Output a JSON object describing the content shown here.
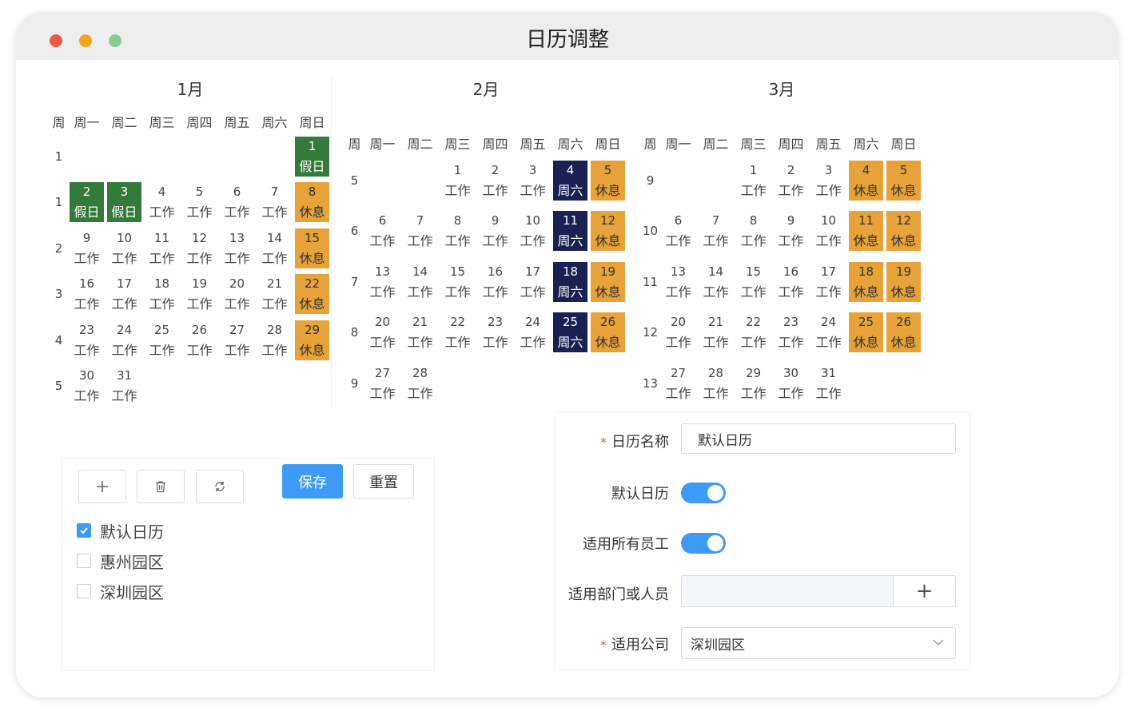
{
  "window": {
    "title": "日历调整"
  },
  "weekday_headers": [
    "周",
    "周一",
    "周二",
    "周三",
    "周四",
    "周五",
    "周六",
    "周日"
  ],
  "months": [
    {
      "title": "1月",
      "weeks": [
        {
          "num": "1",
          "days": [
            null,
            null,
            null,
            null,
            null,
            null,
            {
              "d": "1",
              "t": "假日",
              "type": "holiday"
            }
          ]
        },
        {
          "num": "1",
          "days": [
            {
              "d": "2",
              "t": "假日",
              "type": "holiday"
            },
            {
              "d": "3",
              "t": "假日",
              "type": "holiday"
            },
            {
              "d": "4",
              "t": "工作"
            },
            {
              "d": "5",
              "t": "工作"
            },
            {
              "d": "6",
              "t": "工作"
            },
            {
              "d": "7",
              "t": "工作"
            },
            {
              "d": "8",
              "t": "休息",
              "type": "rest"
            }
          ]
        },
        {
          "num": "2",
          "days": [
            {
              "d": "9",
              "t": "工作"
            },
            {
              "d": "10",
              "t": "工作"
            },
            {
              "d": "11",
              "t": "工作"
            },
            {
              "d": "12",
              "t": "工作"
            },
            {
              "d": "13",
              "t": "工作"
            },
            {
              "d": "14",
              "t": "工作"
            },
            {
              "d": "15",
              "t": "休息",
              "type": "rest"
            }
          ]
        },
        {
          "num": "3",
          "days": [
            {
              "d": "16",
              "t": "工作"
            },
            {
              "d": "17",
              "t": "工作"
            },
            {
              "d": "18",
              "t": "工作"
            },
            {
              "d": "19",
              "t": "工作"
            },
            {
              "d": "20",
              "t": "工作"
            },
            {
              "d": "21",
              "t": "工作"
            },
            {
              "d": "22",
              "t": "休息",
              "type": "rest"
            }
          ]
        },
        {
          "num": "4",
          "days": [
            {
              "d": "23",
              "t": "工作"
            },
            {
              "d": "24",
              "t": "工作"
            },
            {
              "d": "25",
              "t": "工作"
            },
            {
              "d": "26",
              "t": "工作"
            },
            {
              "d": "27",
              "t": "工作"
            },
            {
              "d": "28",
              "t": "工作"
            },
            {
              "d": "29",
              "t": "休息",
              "type": "rest"
            }
          ]
        },
        {
          "num": "5",
          "days": [
            {
              "d": "30",
              "t": "工作"
            },
            {
              "d": "31",
              "t": "工作"
            },
            null,
            null,
            null,
            null,
            null
          ]
        }
      ]
    },
    {
      "title": "2月",
      "weeks": [
        {
          "num": "5",
          "days": [
            null,
            null,
            {
              "d": "1",
              "t": "工作"
            },
            {
              "d": "2",
              "t": "工作"
            },
            {
              "d": "3",
              "t": "工作"
            },
            {
              "d": "4",
              "t": "周六",
              "type": "sat"
            },
            {
              "d": "5",
              "t": "休息",
              "type": "rest"
            }
          ]
        },
        {
          "num": "6",
          "days": [
            {
              "d": "6",
              "t": "工作"
            },
            {
              "d": "7",
              "t": "工作"
            },
            {
              "d": "8",
              "t": "工作"
            },
            {
              "d": "9",
              "t": "工作"
            },
            {
              "d": "10",
              "t": "工作"
            },
            {
              "d": "11",
              "t": "周六",
              "type": "sat"
            },
            {
              "d": "12",
              "t": "休息",
              "type": "rest"
            }
          ]
        },
        {
          "num": "7",
          "days": [
            {
              "d": "13",
              "t": "工作"
            },
            {
              "d": "14",
              "t": "工作"
            },
            {
              "d": "15",
              "t": "工作"
            },
            {
              "d": "16",
              "t": "工作"
            },
            {
              "d": "17",
              "t": "工作"
            },
            {
              "d": "18",
              "t": "周六",
              "type": "sat"
            },
            {
              "d": "19",
              "t": "休息",
              "type": "rest"
            }
          ]
        },
        {
          "num": "8",
          "days": [
            {
              "d": "20",
              "t": "工作"
            },
            {
              "d": "21",
              "t": "工作"
            },
            {
              "d": "22",
              "t": "工作"
            },
            {
              "d": "23",
              "t": "工作"
            },
            {
              "d": "24",
              "t": "工作"
            },
            {
              "d": "25",
              "t": "周六",
              "type": "sat"
            },
            {
              "d": "26",
              "t": "休息",
              "type": "rest"
            }
          ]
        },
        {
          "num": "9",
          "days": [
            {
              "d": "27",
              "t": "工作"
            },
            {
              "d": "28",
              "t": "工作"
            },
            null,
            null,
            null,
            null,
            null
          ]
        }
      ]
    },
    {
      "title": "3月",
      "weeks": [
        {
          "num": "9",
          "days": [
            null,
            null,
            {
              "d": "1",
              "t": "工作"
            },
            {
              "d": "2",
              "t": "工作"
            },
            {
              "d": "3",
              "t": "工作"
            },
            {
              "d": "4",
              "t": "休息",
              "type": "rest"
            },
            {
              "d": "5",
              "t": "休息",
              "type": "rest"
            }
          ]
        },
        {
          "num": "10",
          "days": [
            {
              "d": "6",
              "t": "工作"
            },
            {
              "d": "7",
              "t": "工作"
            },
            {
              "d": "8",
              "t": "工作"
            },
            {
              "d": "9",
              "t": "工作"
            },
            {
              "d": "10",
              "t": "工作"
            },
            {
              "d": "11",
              "t": "休息",
              "type": "rest"
            },
            {
              "d": "12",
              "t": "休息",
              "type": "rest"
            }
          ]
        },
        {
          "num": "11",
          "days": [
            {
              "d": "13",
              "t": "工作"
            },
            {
              "d": "14",
              "t": "工作"
            },
            {
              "d": "15",
              "t": "工作"
            },
            {
              "d": "16",
              "t": "工作"
            },
            {
              "d": "17",
              "t": "工作"
            },
            {
              "d": "18",
              "t": "休息",
              "type": "rest"
            },
            {
              "d": "19",
              "t": "休息",
              "type": "rest"
            }
          ]
        },
        {
          "num": "12",
          "days": [
            {
              "d": "20",
              "t": "工作"
            },
            {
              "d": "21",
              "t": "工作"
            },
            {
              "d": "22",
              "t": "工作"
            },
            {
              "d": "23",
              "t": "工作"
            },
            {
              "d": "24",
              "t": "工作"
            },
            {
              "d": "25",
              "t": "休息",
              "type": "rest"
            },
            {
              "d": "26",
              "t": "休息",
              "type": "rest"
            }
          ]
        },
        {
          "num": "13",
          "days": [
            {
              "d": "27",
              "t": "工作"
            },
            {
              "d": "28",
              "t": "工作"
            },
            {
              "d": "29",
              "t": "工作"
            },
            {
              "d": "30",
              "t": "工作"
            },
            {
              "d": "31",
              "t": "工作"
            },
            null,
            null
          ]
        }
      ]
    }
  ],
  "colors": {
    "holiday": "#347a3a",
    "rest": "#e7a239",
    "saturday_work": "#1a2052",
    "primary": "#3e9bf5"
  },
  "calendar_list": {
    "toolbar": {
      "add_icon": "plus-icon",
      "delete_icon": "trash-icon",
      "refresh_icon": "refresh-icon",
      "save_label": "保存",
      "reset_label": "重置"
    },
    "items": [
      {
        "label": "默认日历",
        "checked": true
      },
      {
        "label": "惠州园区",
        "checked": false
      },
      {
        "label": "深圳园区",
        "checked": false
      }
    ]
  },
  "form": {
    "name_label": "日历名称",
    "name_value": "默认日历",
    "default_label": "默认日历",
    "default_on": true,
    "all_staff_label": "适用所有员工",
    "all_staff_on": true,
    "dept_label": "适用部门或人员",
    "dept_add": "+",
    "company_label": "适用公司",
    "company_value": "深圳园区",
    "required_mark": "*"
  }
}
